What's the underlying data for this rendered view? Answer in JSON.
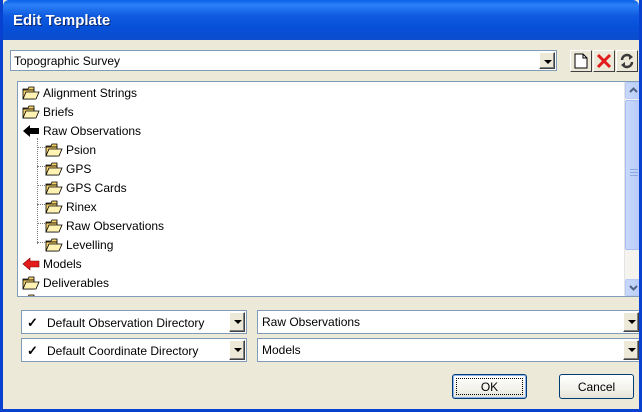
{
  "window": {
    "title": "Edit Template"
  },
  "template_selector": {
    "value": "Topographic Survey"
  },
  "toolbar": {
    "new_icon": "new-document-icon",
    "delete_icon": "delete-x-icon",
    "refresh_icon": "refresh-icon"
  },
  "tree": {
    "items": [
      {
        "label": "Alignment Strings",
        "icon": "open-folder-icon",
        "level": 0
      },
      {
        "label": "Briefs",
        "icon": "open-folder-icon",
        "level": 0
      },
      {
        "label": "Raw Observations",
        "icon": "black-arrow-icon",
        "level": 0
      },
      {
        "label": "Psion",
        "icon": "open-folder-icon",
        "level": 1
      },
      {
        "label": "GPS",
        "icon": "open-folder-icon",
        "level": 1
      },
      {
        "label": "GPS Cards",
        "icon": "open-folder-icon",
        "level": 1
      },
      {
        "label": "Rinex",
        "icon": "open-folder-icon",
        "level": 1
      },
      {
        "label": "Raw Observations",
        "icon": "open-folder-icon",
        "level": 1
      },
      {
        "label": "Levelling",
        "icon": "open-folder-icon",
        "level": 1
      },
      {
        "label": "Models",
        "icon": "red-arrow-icon",
        "level": 0
      },
      {
        "label": "Deliverables",
        "icon": "open-folder-icon",
        "level": 0
      }
    ]
  },
  "settings": [
    {
      "check": "✓",
      "label": "Default Observation Directory",
      "value": "Raw Observations"
    },
    {
      "check": "✓",
      "label": "Default Coordinate Directory",
      "value": "Models"
    }
  ],
  "buttons": {
    "ok": "OK",
    "cancel": "Cancel"
  },
  "colors": {
    "title_bar": "#0a5fe8",
    "face": "#ece9d8",
    "delete_red": "#e21b1b",
    "folder_yellow": "#f6d26a"
  }
}
